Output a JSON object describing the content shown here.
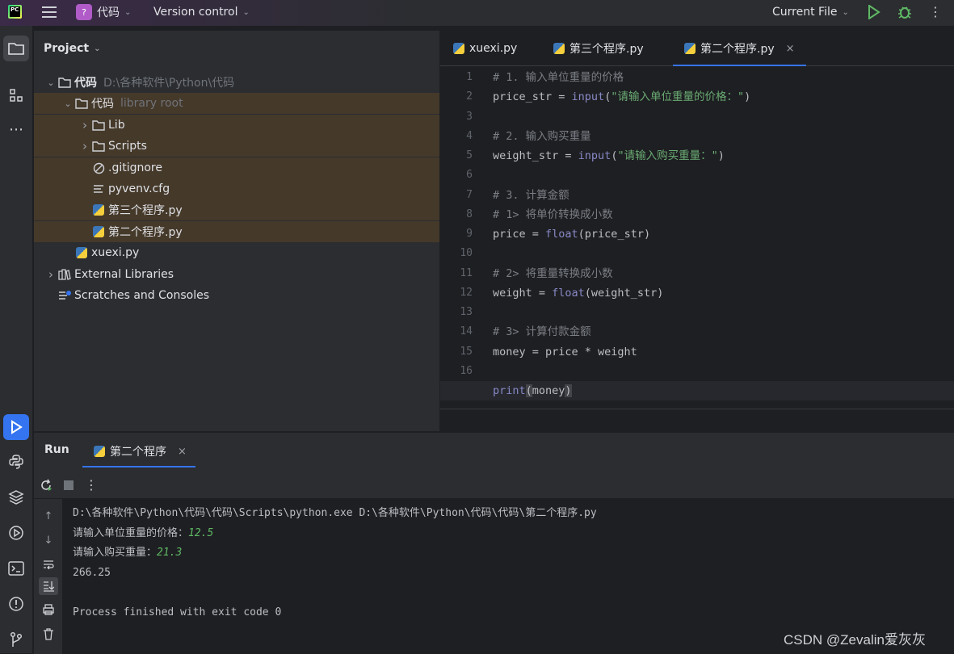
{
  "titlebar": {
    "logo_text": "PC",
    "project_name": "代码",
    "project_badge": "?",
    "vcs": "Version control",
    "run_config": "Current File"
  },
  "project_pane": {
    "title": "Project",
    "tree": [
      {
        "label": "代码",
        "hint": "D:\\各种软件\\Python\\代码",
        "indent": 0,
        "arrow": "expanded",
        "icon": "folder-icon",
        "bold": true
      },
      {
        "label": "代码",
        "hint": "library root",
        "indent": 1,
        "arrow": "expanded",
        "icon": "folder-icon",
        "highlight": true
      },
      {
        "label": "Lib",
        "indent": 2,
        "arrow": "collapsed",
        "icon": "folder-icon",
        "highlight": true
      },
      {
        "label": "Scripts",
        "indent": 2,
        "arrow": "collapsed",
        "icon": "folder-icon",
        "highlight": true
      },
      {
        "label": ".gitignore",
        "indent": 2,
        "arrow": "none",
        "icon": "ignore-file-icon",
        "highlight": true
      },
      {
        "label": "pyvenv.cfg",
        "indent": 2,
        "arrow": "none",
        "icon": "text-file-icon",
        "highlight": true
      },
      {
        "label": "第三个程序.py",
        "indent": 2,
        "arrow": "none",
        "icon": "python-file-icon",
        "highlight": true
      },
      {
        "label": "第二个程序.py",
        "indent": 2,
        "arrow": "none",
        "icon": "python-file-icon",
        "highlight": true
      },
      {
        "label": "xuexi.py",
        "indent": 1,
        "arrow": "none",
        "icon": "python-file-icon"
      },
      {
        "label": "External Libraries",
        "indent": 0,
        "arrow": "collapsed",
        "icon": "library-icon"
      },
      {
        "label": "Scratches and Consoles",
        "indent": 0,
        "arrow": "none",
        "icon": "scratches-icon"
      }
    ]
  },
  "editor": {
    "tabs": [
      {
        "label": "xuexi.py",
        "active": false
      },
      {
        "label": "第三个程序.py",
        "active": false
      },
      {
        "label": "第二个程序.py",
        "active": true,
        "close": "×"
      }
    ],
    "current_line": 17,
    "lines": [
      "# 1. 输入单位重量的价格",
      "price_str = input(\"请输入单位重量的价格：\")",
      "",
      "# 2. 输入购买重量",
      "weight_str = input(\"请输入购买重量：\")",
      "",
      "# 3. 计算金额",
      "# 1> 将单价转换成小数",
      "price = float(price_str)",
      "",
      "# 2> 将重量转换成小数",
      "weight = float(weight_str)",
      "",
      "# 3> 计算付款金额",
      "money = price * weight",
      "",
      "print(money)"
    ]
  },
  "run_pane": {
    "title": "Run",
    "tab_label": "第二个程序",
    "tab_close": "×",
    "console": {
      "command": "D:\\各种软件\\Python\\代码\\代码\\Scripts\\python.exe D:\\各种软件\\Python\\代码\\代码\\第二个程序.py",
      "prompt1": "请输入单位重量的价格：",
      "input1": "12.5",
      "prompt2": "请输入购买重量：",
      "input2": "21.3",
      "result": "266.25",
      "finish": "Process finished with exit code 0"
    }
  },
  "watermark": "CSDN @Zevalin爱灰灰"
}
